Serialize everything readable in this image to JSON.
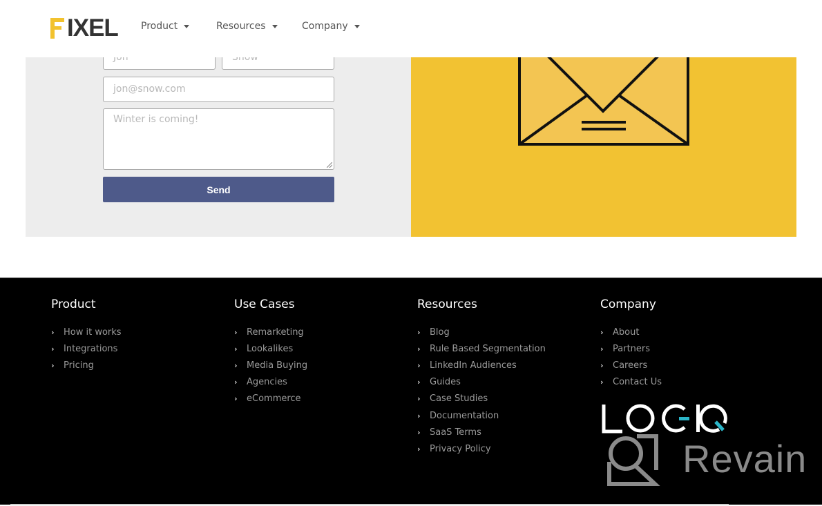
{
  "header": {
    "logo_text": "IXEL",
    "logo_full": "FIXEL",
    "nav": [
      {
        "label": "Product"
      },
      {
        "label": "Resources"
      },
      {
        "label": "Company"
      }
    ]
  },
  "contact_form": {
    "first_name_placeholder": "Jon",
    "last_name_placeholder": "Snow",
    "email_placeholder": "jon@snow.com",
    "message_placeholder": "Winter is coming!",
    "send_label": "Send"
  },
  "colors": {
    "brand_yellow": "#f2c232",
    "button": "#4e5a8a",
    "footer_bg": "#000000",
    "logiq_accent": "#2bb6c9"
  },
  "footer": {
    "columns": [
      {
        "title": "Product",
        "links": [
          "How it works",
          "Integrations",
          "Pricing"
        ]
      },
      {
        "title": "Use Cases",
        "links": [
          "Remarketing",
          "Lookalikes",
          "Media Buying",
          "Agencies",
          "eCommerce"
        ]
      },
      {
        "title": "Resources",
        "links": [
          "Blog",
          "Rule Based Segmentation",
          "LinkedIn Audiences",
          "Guides",
          "Case Studies",
          "Documentation",
          "SaaS Terms",
          "Privacy Policy"
        ]
      },
      {
        "title": "Company",
        "links": [
          "About",
          "Partners",
          "Careers",
          "Contact Us"
        ]
      }
    ],
    "logiq_logo": "LOGIQ",
    "watermark": "Revain"
  }
}
